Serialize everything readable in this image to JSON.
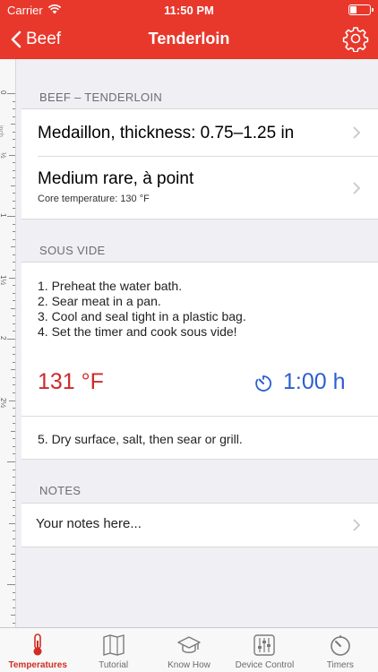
{
  "status": {
    "carrier": "Carrier",
    "time": "11:50 PM"
  },
  "nav": {
    "back_label": "Beef",
    "title": "Tenderloin"
  },
  "ruler": {
    "unit": "inch",
    "labels": [
      "0",
      "½",
      "1",
      "1½",
      "2",
      "2½"
    ]
  },
  "cut_section": {
    "header": "BEEF – TENDERLOIN",
    "rows": [
      {
        "title": "Medaillon, thickness: 0.75–1.25 in"
      },
      {
        "title": "Medium rare, à point",
        "subtitle": "Core temperature: 130 °F"
      }
    ]
  },
  "sous_vide": {
    "header": "SOUS VIDE",
    "steps": [
      "1. Preheat the water bath.",
      "2. Sear meat in a pan.",
      "3. Cool and seal tight in a plastic bag.",
      "4. Set the timer and cook sous vide!"
    ],
    "temperature": "131 °F",
    "duration": "1:00 h",
    "final_step": "5. Dry surface, salt, then sear or grill."
  },
  "notes": {
    "header": "NOTES",
    "placeholder": "Your notes here..."
  },
  "tabs": [
    {
      "label": "Temperatures",
      "active": true
    },
    {
      "label": "Tutorial"
    },
    {
      "label": "Know How"
    },
    {
      "label": "Device Control"
    },
    {
      "label": "Timers"
    }
  ],
  "colors": {
    "accent": "#e8382c",
    "temperature": "#cf2a2a",
    "timer": "#2b5fd0"
  }
}
